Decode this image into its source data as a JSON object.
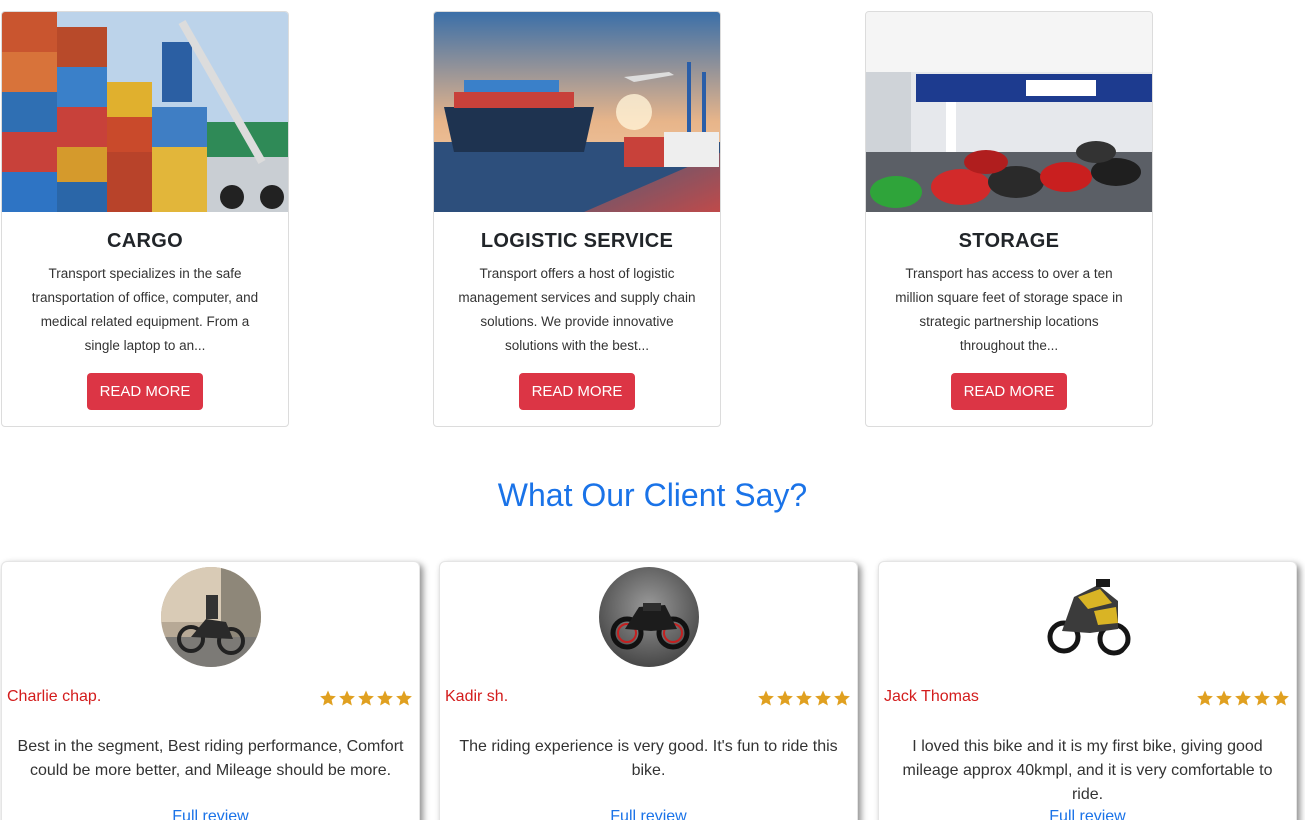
{
  "services": [
    {
      "title": "CARGO",
      "description": "Transport specializes in the safe transportation of office, computer, and medical related equipment. From a single laptop to an...",
      "button": "READ MORE",
      "image_icon": "cargo-containers-image"
    },
    {
      "title": "LOGISTIC SERVICE",
      "description": "Transport offers a host of logistic management services and supply chain solutions. We provide innovative solutions with the best...",
      "button": "READ MORE",
      "image_icon": "ship-plane-truck-image"
    },
    {
      "title": "STORAGE",
      "description": "Transport has access to over a ten million square feet of storage space in strategic partnership locations throughout the...",
      "button": "READ MORE",
      "image_icon": "motorcycle-showroom-image"
    }
  ],
  "testimonials": {
    "heading": "What Our Client Say?",
    "reviews": [
      {
        "name": "Charlie chap.",
        "rating": 5,
        "text": "Best in the segment, Best riding performance, Comfort could be more better, and Mileage should be more.",
        "link": "Full review"
      },
      {
        "name": "Kadir sh.",
        "rating": 5,
        "text": "The riding experience is very good. It's fun to ride this bike.",
        "link": "Full review"
      },
      {
        "name": "Jack Thomas",
        "rating": 5,
        "text": "I loved this bike and it is my first bike, giving good mileage approx 40kmpl, and it is very comfortable to ride.",
        "link": "Full review"
      }
    ]
  },
  "colors": {
    "accent_button": "#dc3545",
    "heading_blue": "#1a73e8",
    "name_red": "#d31c1c",
    "star_gold": "#e0a020"
  }
}
